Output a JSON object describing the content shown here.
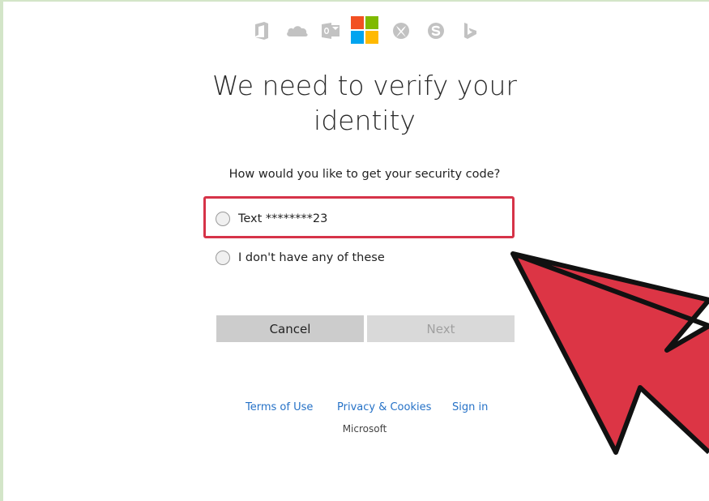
{
  "product_icons": [
    {
      "name": "office-icon"
    },
    {
      "name": "onedrive-icon"
    },
    {
      "name": "outlook-icon"
    },
    {
      "name": "microsoft-logo"
    },
    {
      "name": "xbox-icon"
    },
    {
      "name": "skype-icon"
    },
    {
      "name": "bing-icon"
    }
  ],
  "colors": {
    "logo_red": "#f25022",
    "logo_green": "#7fba00",
    "logo_blue": "#00a4ef",
    "logo_yellow": "#ffb900",
    "highlight_red": "#d63348",
    "link_blue": "#2672c7"
  },
  "page": {
    "title_line1": "We need to verify your",
    "title_line2": "identity",
    "question": "How would you like to get your security code?"
  },
  "options": [
    {
      "label": "Text ********23",
      "selected": false
    },
    {
      "label": "I don't have any of these",
      "selected": false
    }
  ],
  "buttons": {
    "cancel": "Cancel",
    "next": "Next"
  },
  "footer": {
    "terms": "Terms of Use",
    "privacy": "Privacy & Cookies",
    "signin": "Sign in",
    "brand": "Microsoft"
  }
}
